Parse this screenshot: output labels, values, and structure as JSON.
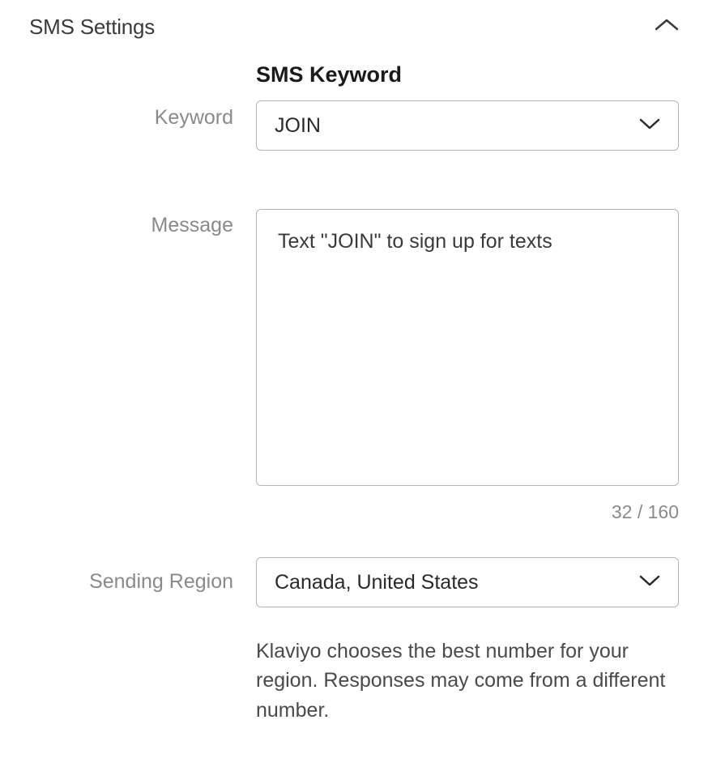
{
  "section": {
    "title": "SMS Settings"
  },
  "keyword": {
    "label": "Keyword",
    "title": "SMS Keyword",
    "value": "JOIN"
  },
  "message": {
    "label": "Message",
    "value": "Text \"JOIN\" to sign up for texts",
    "char_count": "32 / 160"
  },
  "region": {
    "label": "Sending Region",
    "value": "Canada, United States",
    "helper": "Klaviyo chooses the best number for your region. Responses may come from a different number."
  }
}
